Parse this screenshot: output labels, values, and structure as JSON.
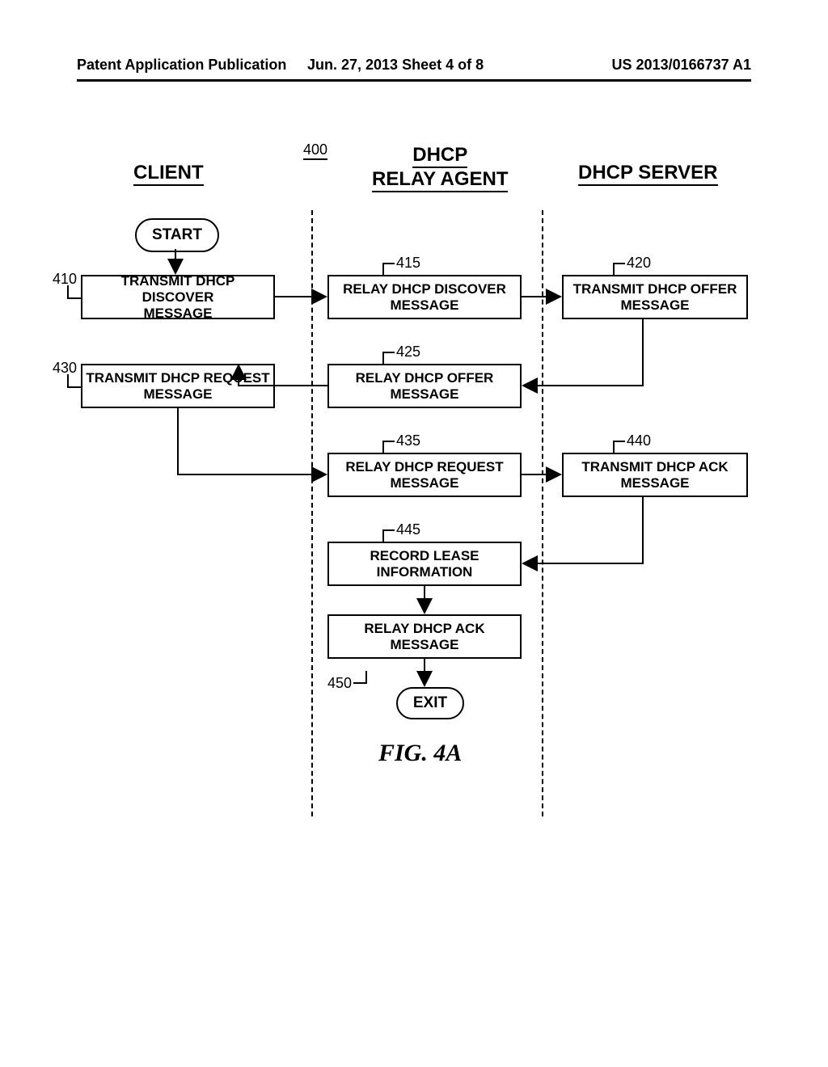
{
  "header": {
    "left": "Patent Application Publication",
    "center": "Jun. 27, 2013  Sheet 4 of 8",
    "right": "US 2013/0166737 A1"
  },
  "columns": {
    "client": "CLIENT",
    "relay_line1": "DHCP",
    "relay_line2": "RELAY AGENT",
    "server": "DHCP SERVER"
  },
  "nodes": {
    "start": "START",
    "exit": "EXIT",
    "n410": "TRANSMIT DHCP DISCOVER\nMESSAGE",
    "n415": "RELAY DHCP DISCOVER\nMESSAGE",
    "n420": "TRANSMIT DHCP OFFER\nMESSAGE",
    "n425": "RELAY DHCP OFFER\nMESSAGE",
    "n430": "TRANSMIT DHCP REQUEST\nMESSAGE",
    "n435": "RELAY DHCP REQUEST\nMESSAGE",
    "n440": "TRANSMIT DHCP ACK\nMESSAGE",
    "n445": "RECORD LEASE\nINFORMATION",
    "n450": "RELAY DHCP ACK\nMESSAGE"
  },
  "refs": {
    "diagram": "400",
    "r410": "410",
    "r415": "415",
    "r420": "420",
    "r425": "425",
    "r430": "430",
    "r435": "435",
    "r440": "440",
    "r445": "445",
    "r450": "450"
  },
  "figure": "FIG. 4A"
}
